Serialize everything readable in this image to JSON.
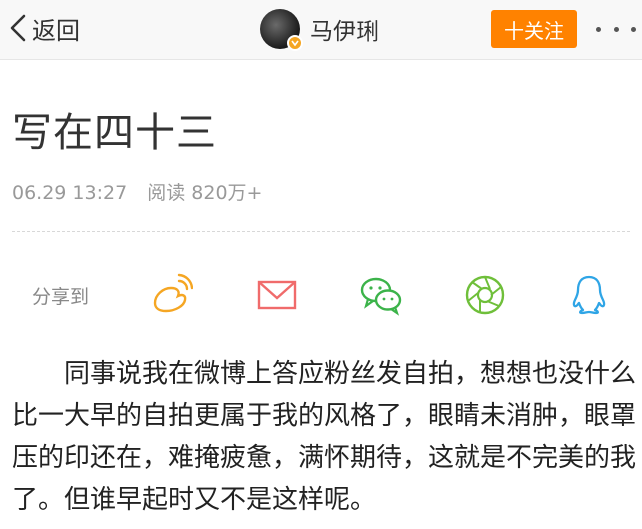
{
  "header": {
    "back_label": "返回",
    "author_name": "马伊琍",
    "follow_label": "十关注"
  },
  "article": {
    "title": "写在四十三",
    "date": "06.29 13:27",
    "reads": "阅读 820万+",
    "body": "同事说我在微博上答应粉丝发自拍，想想也没什么比一大早的自拍更属于我的风格了，眼睛未消肿，眼罩压的印还在，难掩疲惫，满怀期待，这就是不完美的我了。但谁早起时又不是这样呢。"
  },
  "share": {
    "label": "分享到",
    "targets": [
      "weibo-icon",
      "mail-icon",
      "wechat-icon",
      "moments-icon",
      "qq-icon"
    ]
  },
  "colors": {
    "accent": "#ff8200",
    "weibo": "#f5a623",
    "mail": "#f06b6b",
    "wechat": "#3cb34a",
    "moments": "#6fbf3a",
    "qq": "#2fa5e6"
  }
}
